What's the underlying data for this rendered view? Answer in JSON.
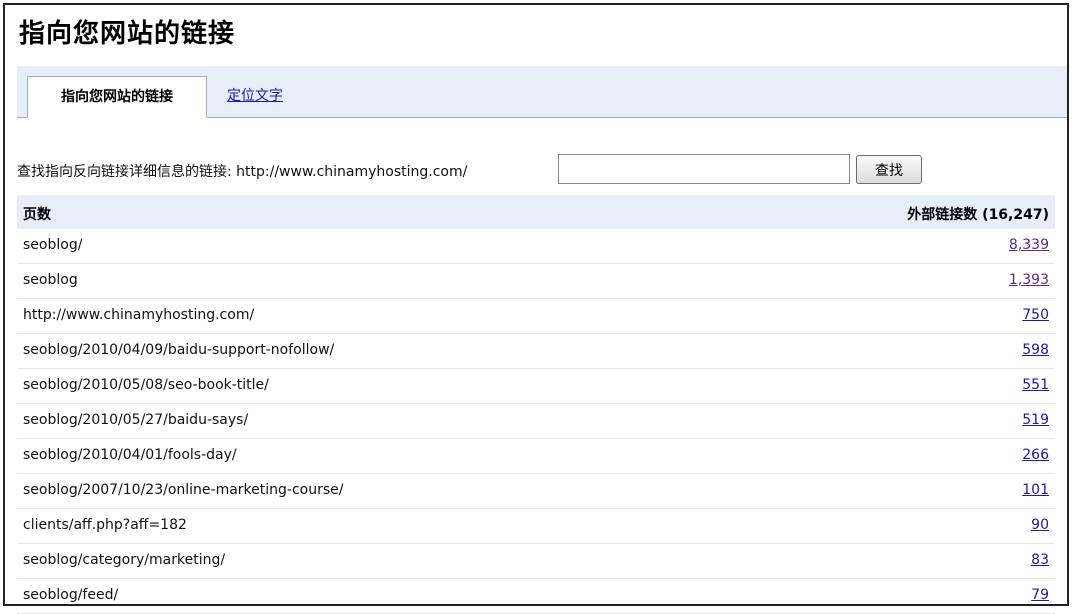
{
  "page_title": "指向您网站的链接",
  "tabs": [
    {
      "label": "指向您网站的链接",
      "active": true
    },
    {
      "label": "定位文字",
      "active": false
    }
  ],
  "search": {
    "label": "查找指向反向链接详细信息的链接: http://www.chinamyhosting.com/",
    "input_value": "",
    "button_label": "查找"
  },
  "table": {
    "header_page": "页数",
    "header_count": "外部链接数 (16,247)",
    "rows": [
      {
        "page": "seoblog/",
        "count": "8,339",
        "visited": true
      },
      {
        "page": "seoblog",
        "count": "1,393",
        "visited": true
      },
      {
        "page": "http://www.chinamyhosting.com/",
        "count": "750",
        "visited": false
      },
      {
        "page": "seoblog/2010/04/09/baidu-support-nofollow/",
        "count": "598",
        "visited": false
      },
      {
        "page": "seoblog/2010/05/08/seo-book-title/",
        "count": "551",
        "visited": false
      },
      {
        "page": "seoblog/2010/05/27/baidu-says/",
        "count": "519",
        "visited": false
      },
      {
        "page": "seoblog/2010/04/01/fools-day/",
        "count": "266",
        "visited": false
      },
      {
        "page": "seoblog/2007/10/23/online-marketing-course/",
        "count": "101",
        "visited": false
      },
      {
        "page": "clients/aff.php?aff=182",
        "count": "90",
        "visited": false
      },
      {
        "page": "seoblog/category/marketing/",
        "count": "83",
        "visited": false
      },
      {
        "page": "seoblog/feed/",
        "count": "79",
        "visited": false
      }
    ]
  }
}
